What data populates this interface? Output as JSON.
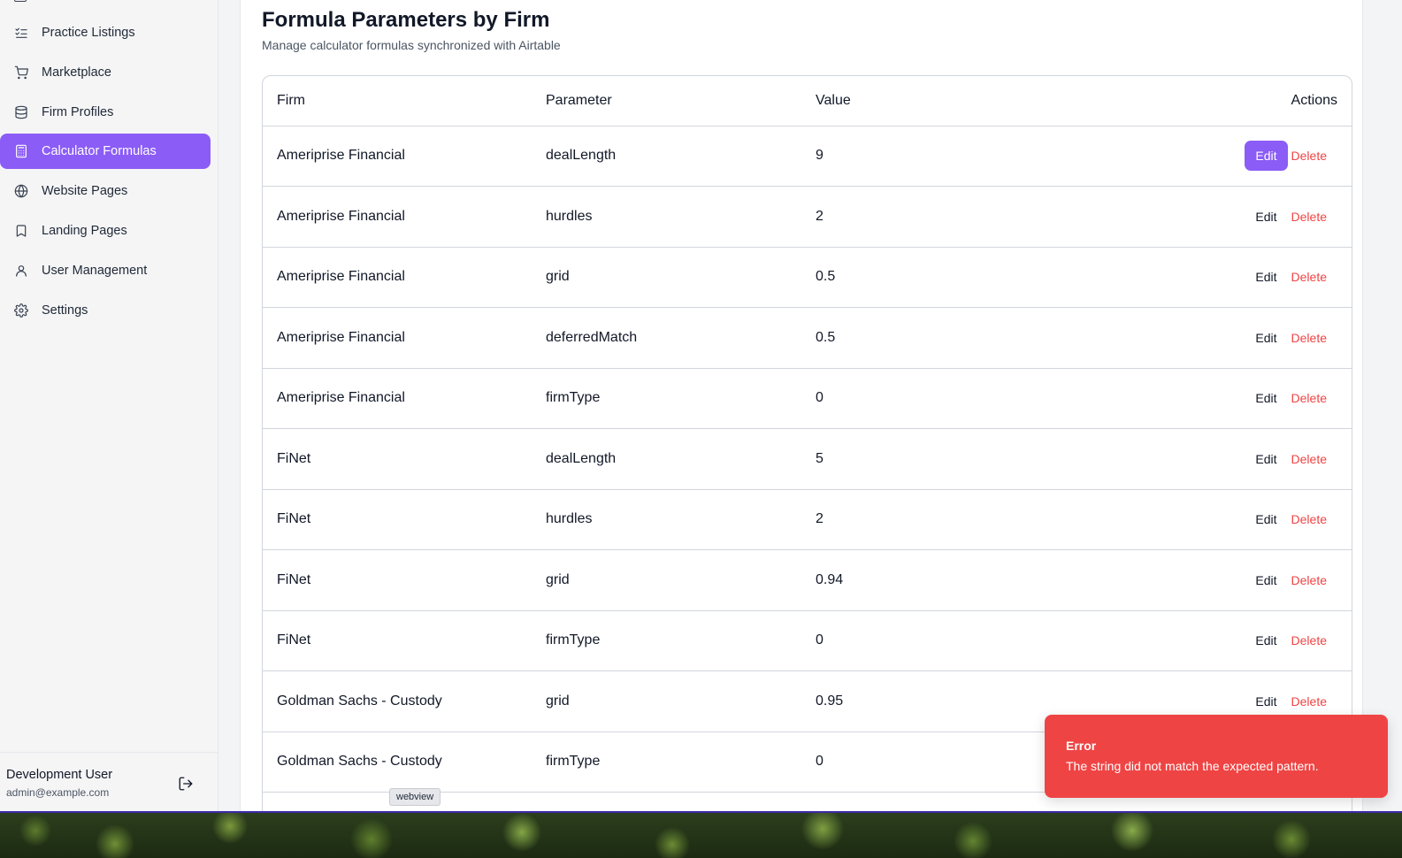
{
  "sidebar": {
    "items": [
      {
        "label": "Practice Listings",
        "icon": "list-check-icon",
        "active": false
      },
      {
        "label": "Marketplace",
        "icon": "shopping-cart-icon",
        "active": false
      },
      {
        "label": "Firm Profiles",
        "icon": "database-icon",
        "active": false
      },
      {
        "label": "Calculator Formulas",
        "icon": "calculator-icon",
        "active": true
      },
      {
        "label": "Website Pages",
        "icon": "globe-icon",
        "active": false
      },
      {
        "label": "Landing Pages",
        "icon": "bookmark-icon",
        "active": false
      },
      {
        "label": "User Management",
        "icon": "user-icon",
        "active": false
      },
      {
        "label": "Settings",
        "icon": "gear-icon",
        "active": false
      }
    ],
    "user": {
      "name": "Development User",
      "email": "admin@example.com"
    }
  },
  "page": {
    "title": "Formula Parameters by Firm",
    "subtitle": "Manage calculator formulas synchronized with Airtable"
  },
  "table": {
    "headers": {
      "firm": "Firm",
      "parameter": "Parameter",
      "value": "Value",
      "actions": "Actions"
    },
    "edit_label": "Edit",
    "delete_label": "Delete",
    "rows": [
      {
        "firm": "Ameriprise Financial",
        "parameter": "dealLength",
        "value": "9"
      },
      {
        "firm": "Ameriprise Financial",
        "parameter": "hurdles",
        "value": "2"
      },
      {
        "firm": "Ameriprise Financial",
        "parameter": "grid",
        "value": "0.5"
      },
      {
        "firm": "Ameriprise Financial",
        "parameter": "deferredMatch",
        "value": "0.5"
      },
      {
        "firm": "Ameriprise Financial",
        "parameter": "firmType",
        "value": "0"
      },
      {
        "firm": "FiNet",
        "parameter": "dealLength",
        "value": "5"
      },
      {
        "firm": "FiNet",
        "parameter": "hurdles",
        "value": "2"
      },
      {
        "firm": "FiNet",
        "parameter": "grid",
        "value": "0.94"
      },
      {
        "firm": "FiNet",
        "parameter": "firmType",
        "value": "0"
      },
      {
        "firm": "Goldman Sachs - Custody",
        "parameter": "grid",
        "value": "0.95"
      },
      {
        "firm": "Goldman Sachs - Custody",
        "parameter": "firmType",
        "value": "0"
      }
    ]
  },
  "tooltip": {
    "text": "webview"
  },
  "toast": {
    "title": "Error",
    "message": "The string did not match the expected pattern."
  },
  "colors": {
    "accent": "#8b5cf6",
    "danger": "#ef4444"
  }
}
